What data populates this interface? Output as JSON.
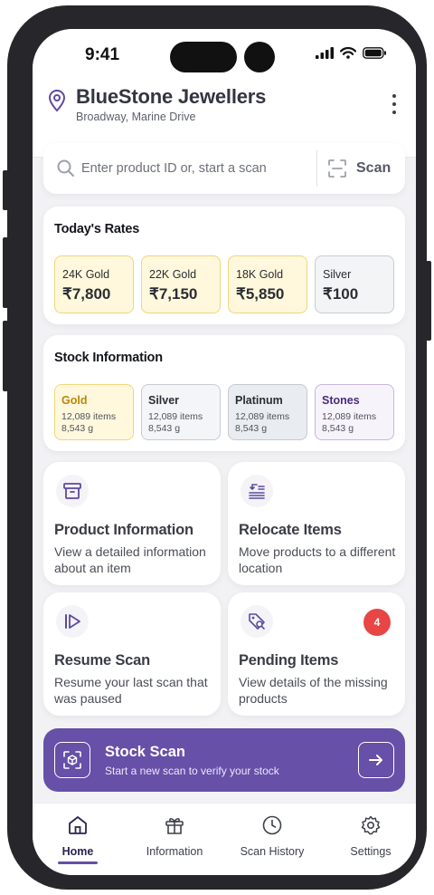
{
  "status_bar": {
    "time": "9:41"
  },
  "header": {
    "store_name": "BlueStone Jewellers",
    "store_location": "Broadway, Marine Drive",
    "icons": {
      "location": "location-pin-icon",
      "menu": "more-vertical-icon"
    }
  },
  "search": {
    "placeholder": "Enter product ID or, start a scan",
    "scan_label": "Scan"
  },
  "rates": {
    "title": "Today's Rates",
    "items": [
      {
        "label": "24K Gold",
        "value": "₹7,800"
      },
      {
        "label": "22K Gold",
        "value": "₹7,150"
      },
      {
        "label": "18K Gold",
        "value": "₹5,850"
      },
      {
        "label": "Silver",
        "value": "₹100"
      }
    ]
  },
  "stock": {
    "title": "Stock Information",
    "items": [
      {
        "name": "Gold",
        "items": "12,089 items",
        "weight": "8,543 g"
      },
      {
        "name": "Silver",
        "items": "12,089 items",
        "weight": "8,543 g"
      },
      {
        "name": "Platinum",
        "items": "12,089 items",
        "weight": "8,543 g"
      },
      {
        "name": "Stones",
        "items": "12,089 items",
        "weight": "8,543 g"
      }
    ]
  },
  "actions": [
    {
      "title": "Product Information",
      "description": "View a detailed information about an item",
      "icon": "archive-box-icon"
    },
    {
      "title": "Relocate Items",
      "description": "Move products to a different location",
      "icon": "relocate-icon"
    },
    {
      "title": "Resume Scan",
      "description": "Resume your last scan that was paused",
      "icon": "resume-play-icon"
    },
    {
      "title": "Pending Items",
      "description": "View details of the missing products",
      "icon": "tag-search-icon",
      "badge": "4"
    }
  ],
  "stock_scan": {
    "title": "Stock Scan",
    "subtitle": "Start a new scan to verify your stock"
  },
  "bottom_nav": [
    {
      "label": "Home",
      "icon": "home-icon",
      "active": true
    },
    {
      "label": "Information",
      "icon": "gift-icon"
    },
    {
      "label": "Scan History",
      "icon": "clock-icon"
    },
    {
      "label": "Settings",
      "icon": "gear-icon"
    }
  ],
  "colors": {
    "accent": "#6650a8",
    "gold_bg": "#fff8dc",
    "gold_border": "#f2d47a",
    "badge": "#e84545"
  }
}
